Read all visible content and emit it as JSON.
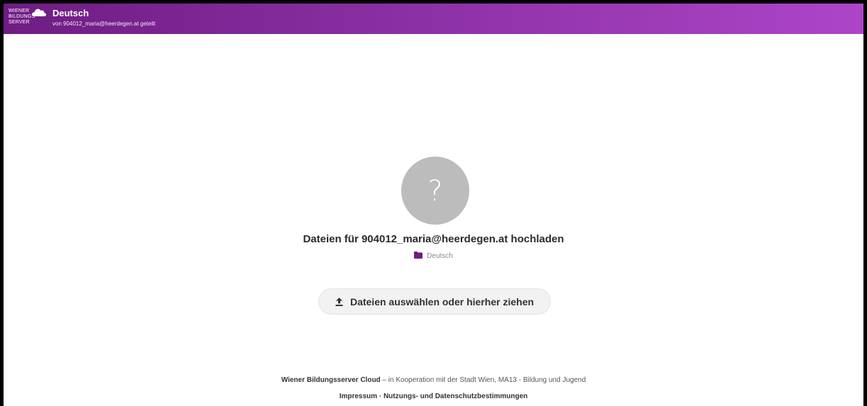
{
  "header": {
    "logo_text": "WIENER\nBILDUNGS\nSERVER",
    "logo_icon": "cloud-icon",
    "title": "Deutsch",
    "subtitle": "von 904012_maria@heerdegen.at geteilt",
    "gradient": [
      "#6f1c83",
      "#ad45c8"
    ]
  },
  "main": {
    "avatar_glyph": "?",
    "upload_title": "Dateien für 904012_maria@heerdegen.at hochladen",
    "folder_icon": "folder-icon",
    "folder_name": "Deutsch",
    "folder_color": "#6f1c83",
    "upload_icon": "upload-icon",
    "upload_button_label": "Dateien auswählen oder hierher ziehen"
  },
  "footer": {
    "brand": "Wiener Bildungsserver Cloud",
    "tagline": " – in Kooperation mit der Stadt Wien, MA13 - Bildung und Jugend",
    "impressum_label": "Impressum",
    "separator": " · ",
    "terms_label": "Nutzungs- und Datenschutzbestimmungen"
  }
}
